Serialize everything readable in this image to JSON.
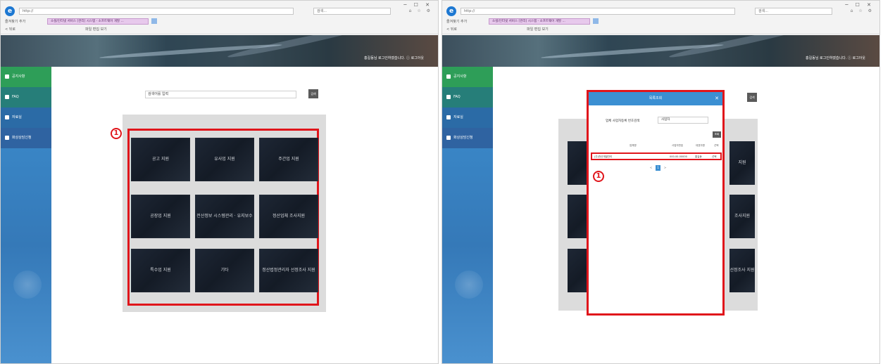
{
  "browser": {
    "address": "http://                                                       ",
    "search_placeholder": "검색...",
    "tab_title": "소셜/인터넷 서비스 [관리] 시스템 - 소프트웨어 개발 ...",
    "favorites_label": "즐겨찾기 추가",
    "back_label": "< 뒤로",
    "command_label": "파일  편집  보기",
    "window_controls": "─ ☐ ✕",
    "toolbar_icons": "⌂ ☆ ⚙"
  },
  "banner": {
    "user_text": "홍길동님 로그인하였습니다.   ⓘ 로그아웃"
  },
  "sidebar": {
    "items": [
      {
        "label": "공지사항",
        "icon": "info-icon",
        "color": "#2e9e58"
      },
      {
        "label": "FAQ",
        "icon": "question-icon",
        "color": "#267e79"
      },
      {
        "label": "자료실",
        "icon": "folder-icon",
        "color": "#2b6ba6"
      },
      {
        "label": "화상상담신청",
        "icon": "video-icon",
        "color": "#2f63a1"
      }
    ]
  },
  "left": {
    "search_value": "검색어를 입력",
    "search_button": "검색",
    "callout": "1",
    "tiles": [
      "공고 지원",
      "유사업 지원",
      "주간업 지원",
      "공장업 지원",
      "전산정보 시스템관리 · 유지보수",
      "정산업체 조사지원",
      "특수업 지원",
      "기타",
      "정산법정관리자 선정조사 지원"
    ]
  },
  "right": {
    "search_button": "검색",
    "callout": "1",
    "modal": {
      "title": "목록조회",
      "close": "✕",
      "label": "업체 사업자등록 번호검색",
      "input_value": "사업자",
      "button": "조회",
      "table_headers": [
        "업체명",
        "사업자번호",
        "대표자명",
        "선택"
      ],
      "row": [
        "(주)전산개발관리",
        "000-00-00000",
        "홍길동",
        "선택"
      ],
      "pages": [
        "<",
        "1",
        ">"
      ]
    },
    "tiles": [
      "지원",
      "조사지원",
      "조사지원",
      "선정조사 지원"
    ]
  },
  "colors": {
    "highlight_red": "#e0151b",
    "sidebar_blue": "#3d8fd0",
    "modal_header": "#3b8fd2",
    "tile_dark": "#1a2230"
  }
}
